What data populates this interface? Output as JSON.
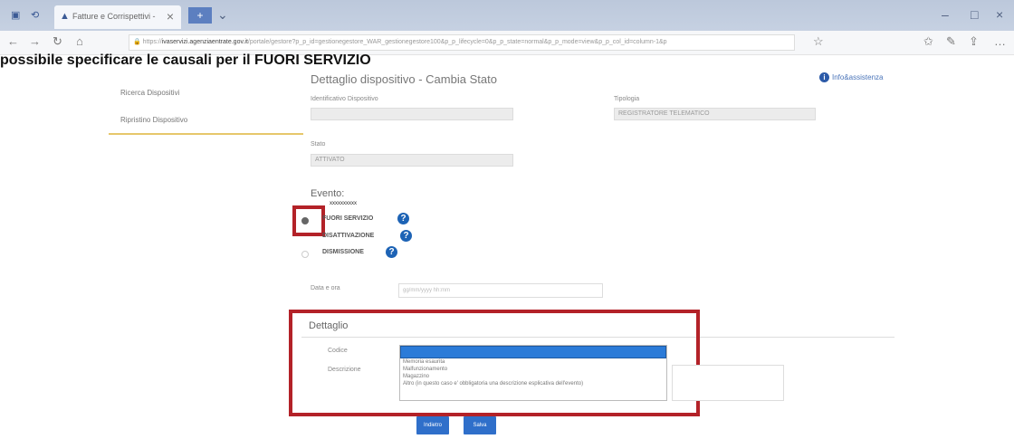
{
  "browser": {
    "tab_title": "Fatture e Corrispettivi -",
    "url_prefix": "https://",
    "url_domain": "ivaservizi.agenziaentrate.gov.it",
    "url_path": "/portale/gestore?p_p_id=gestionegestore_WAR_gestionegestore100&p_p_lifecycle=0&p_p_state=normal&p_p_mode=view&p_p_col_id=column-1&p"
  },
  "overlay_title": "possibile specificare le causali per il FUORI SERVIZIO",
  "sidebar": {
    "items": [
      {
        "label": "Ricerca Dispositivi"
      },
      {
        "label": "Ripristino Dispositivo"
      }
    ]
  },
  "page": {
    "title": "Dettaglio dispositivo - Cambia Stato",
    "info_label": "Info&assistenza",
    "identificativo_label": "Identificativo Dispositivo",
    "identificativo_value": "",
    "tipologia_label": "Tipologia",
    "tipologia_value": "REGISTRATORE TELEMATICO",
    "stato_label": "Stato",
    "stato_value": "ATTIVATO"
  },
  "evento": {
    "title": "Evento:",
    "annotation": "xxxxxxxxxx",
    "options": [
      {
        "label": "FUORI SERVIZIO",
        "selected": true
      },
      {
        "label": "DISATTIVAZIONE",
        "selected": false
      },
      {
        "label": "DISMISSIONE",
        "selected": false
      }
    ]
  },
  "date": {
    "label": "Data e ora",
    "placeholder": "gg/mm/yyyy hh:mm"
  },
  "dettaglio": {
    "title": "Dettaglio",
    "codice_label": "Codice",
    "descrizione_label": "Descrizione",
    "options": [
      "",
      "Memoria esaurita",
      "Malfunzionamento",
      "Magazzino",
      "Altro (in questo caso e' obbligatoria una descrizione esplicativa dell'evento)"
    ]
  },
  "buttons": {
    "back": "Indietro",
    "save": "Salva"
  },
  "colors": {
    "highlight_border": "#b32228",
    "primary_button": "#2f6fca",
    "help_icon": "#1d63b5"
  }
}
